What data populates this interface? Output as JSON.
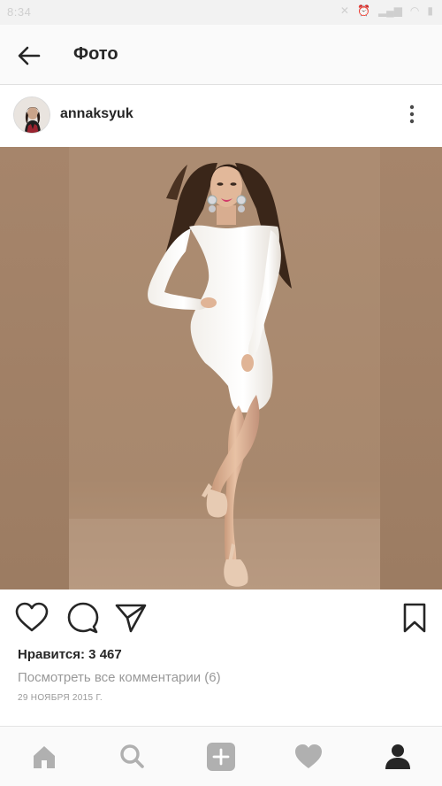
{
  "status_bar": {
    "time": "8:34",
    "icons": [
      "mute-icon",
      "alarm-icon",
      "signal-icon",
      "wifi-icon",
      "battery-icon"
    ]
  },
  "header": {
    "title": "Фото",
    "back_icon": "arrow-left-icon"
  },
  "post": {
    "username": "annaksyuk",
    "more_icon": "more-vertical-icon",
    "photo_description_icon": "photo",
    "likes": "Нравится: 3 467",
    "view_comments": "Посмотреть все комментарии (6)",
    "date": "29 НОЯБРЯ 2015 Г.",
    "actions": [
      "like-icon",
      "comment-icon",
      "share-icon",
      "bookmark-icon"
    ]
  },
  "bottom_nav": {
    "items": [
      "home-icon",
      "search-icon",
      "add-icon",
      "activity-icon",
      "profile-icon"
    ],
    "active": "profile-icon"
  },
  "colors": {
    "icon_dark": "#262626",
    "icon_inactive": "#b0b0b0",
    "secondary_text": "#999999",
    "photo_background": "#a88a72"
  }
}
